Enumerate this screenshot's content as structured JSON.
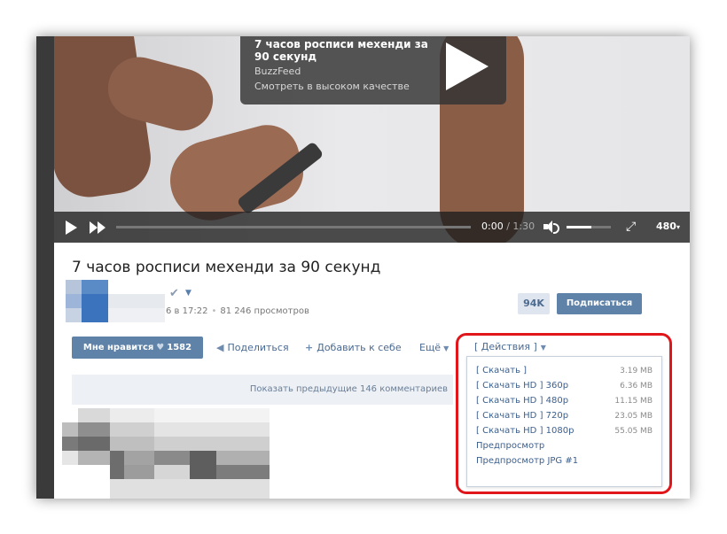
{
  "video": {
    "overlay_title": "7 часов росписи мехенди за 90 секунд",
    "channel": "BuzzFeed",
    "hq_link": "Смотреть в высоком качестве",
    "time_current": "0:00",
    "time_separator": " / ",
    "time_total": "1:30",
    "quality": "480",
    "progress": 0.0,
    "volume": 0.55
  },
  "post": {
    "title": "7 часов росписи мехенди за 90 секунд",
    "date": "6 в 17:22",
    "views": "81 246 просмотров",
    "subscribers_count": "94K",
    "subscribe_label": "Подписаться"
  },
  "actions": {
    "like_label": "Мне нравится",
    "like_count": "1582",
    "share_label": "Поделиться",
    "add_label": "Добавить к себе",
    "more_label": "Ещё"
  },
  "comments": {
    "show_previous": "Показать предыдущие 146 комментариев"
  },
  "dropdown": {
    "header": "[ Действия ]",
    "items": [
      {
        "label": "[ Скачать ]",
        "size": "3.19 MB"
      },
      {
        "label": "[ Скачать HD ] 360p",
        "size": "6.36 MB"
      },
      {
        "label": "[ Скачать HD ] 480p",
        "size": "11.15 MB"
      },
      {
        "label": "[ Скачать HD ] 720p",
        "size": "23.05 MB"
      },
      {
        "label": "[ Скачать HD ] 1080p",
        "size": "55.05 MB"
      },
      {
        "label": "Предпросмотр",
        "size": ""
      },
      {
        "label": "Предпросмотр JPG #1",
        "size": ""
      }
    ]
  },
  "colors": {
    "accent": "#5e82a8",
    "link": "#4a6a93",
    "highlight": "#e0161b"
  }
}
